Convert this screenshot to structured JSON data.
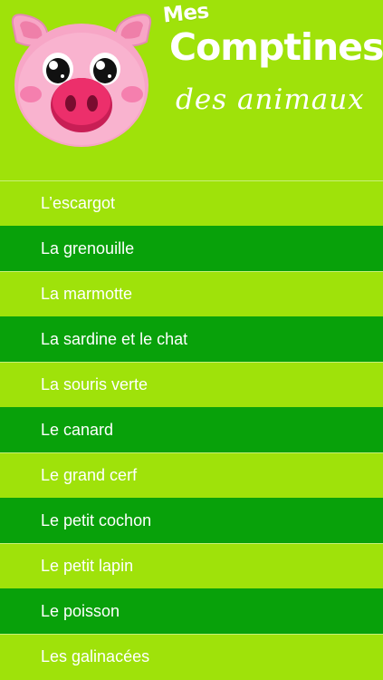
{
  "header": {
    "title_small": "Mes",
    "title_main": "Comptines",
    "title_sub": "des animaux"
  },
  "list": {
    "items": [
      {
        "label": "L’escargot"
      },
      {
        "label": "La grenouille"
      },
      {
        "label": "La marmotte"
      },
      {
        "label": "La sardine et le chat"
      },
      {
        "label": "La souris verte"
      },
      {
        "label": "Le canard"
      },
      {
        "label": "Le grand cerf"
      },
      {
        "label": "Le petit cochon"
      },
      {
        "label": "Le petit lapin"
      },
      {
        "label": "Le poisson"
      },
      {
        "label": "Les galinacées"
      }
    ]
  },
  "colors": {
    "background_light": "#9fe20a",
    "row_dark": "#08a10a",
    "pig_pink": "#f7a6c6",
    "snout": "#ec2f6b"
  },
  "icons": {
    "mascot": "pig-mascot-icon"
  }
}
